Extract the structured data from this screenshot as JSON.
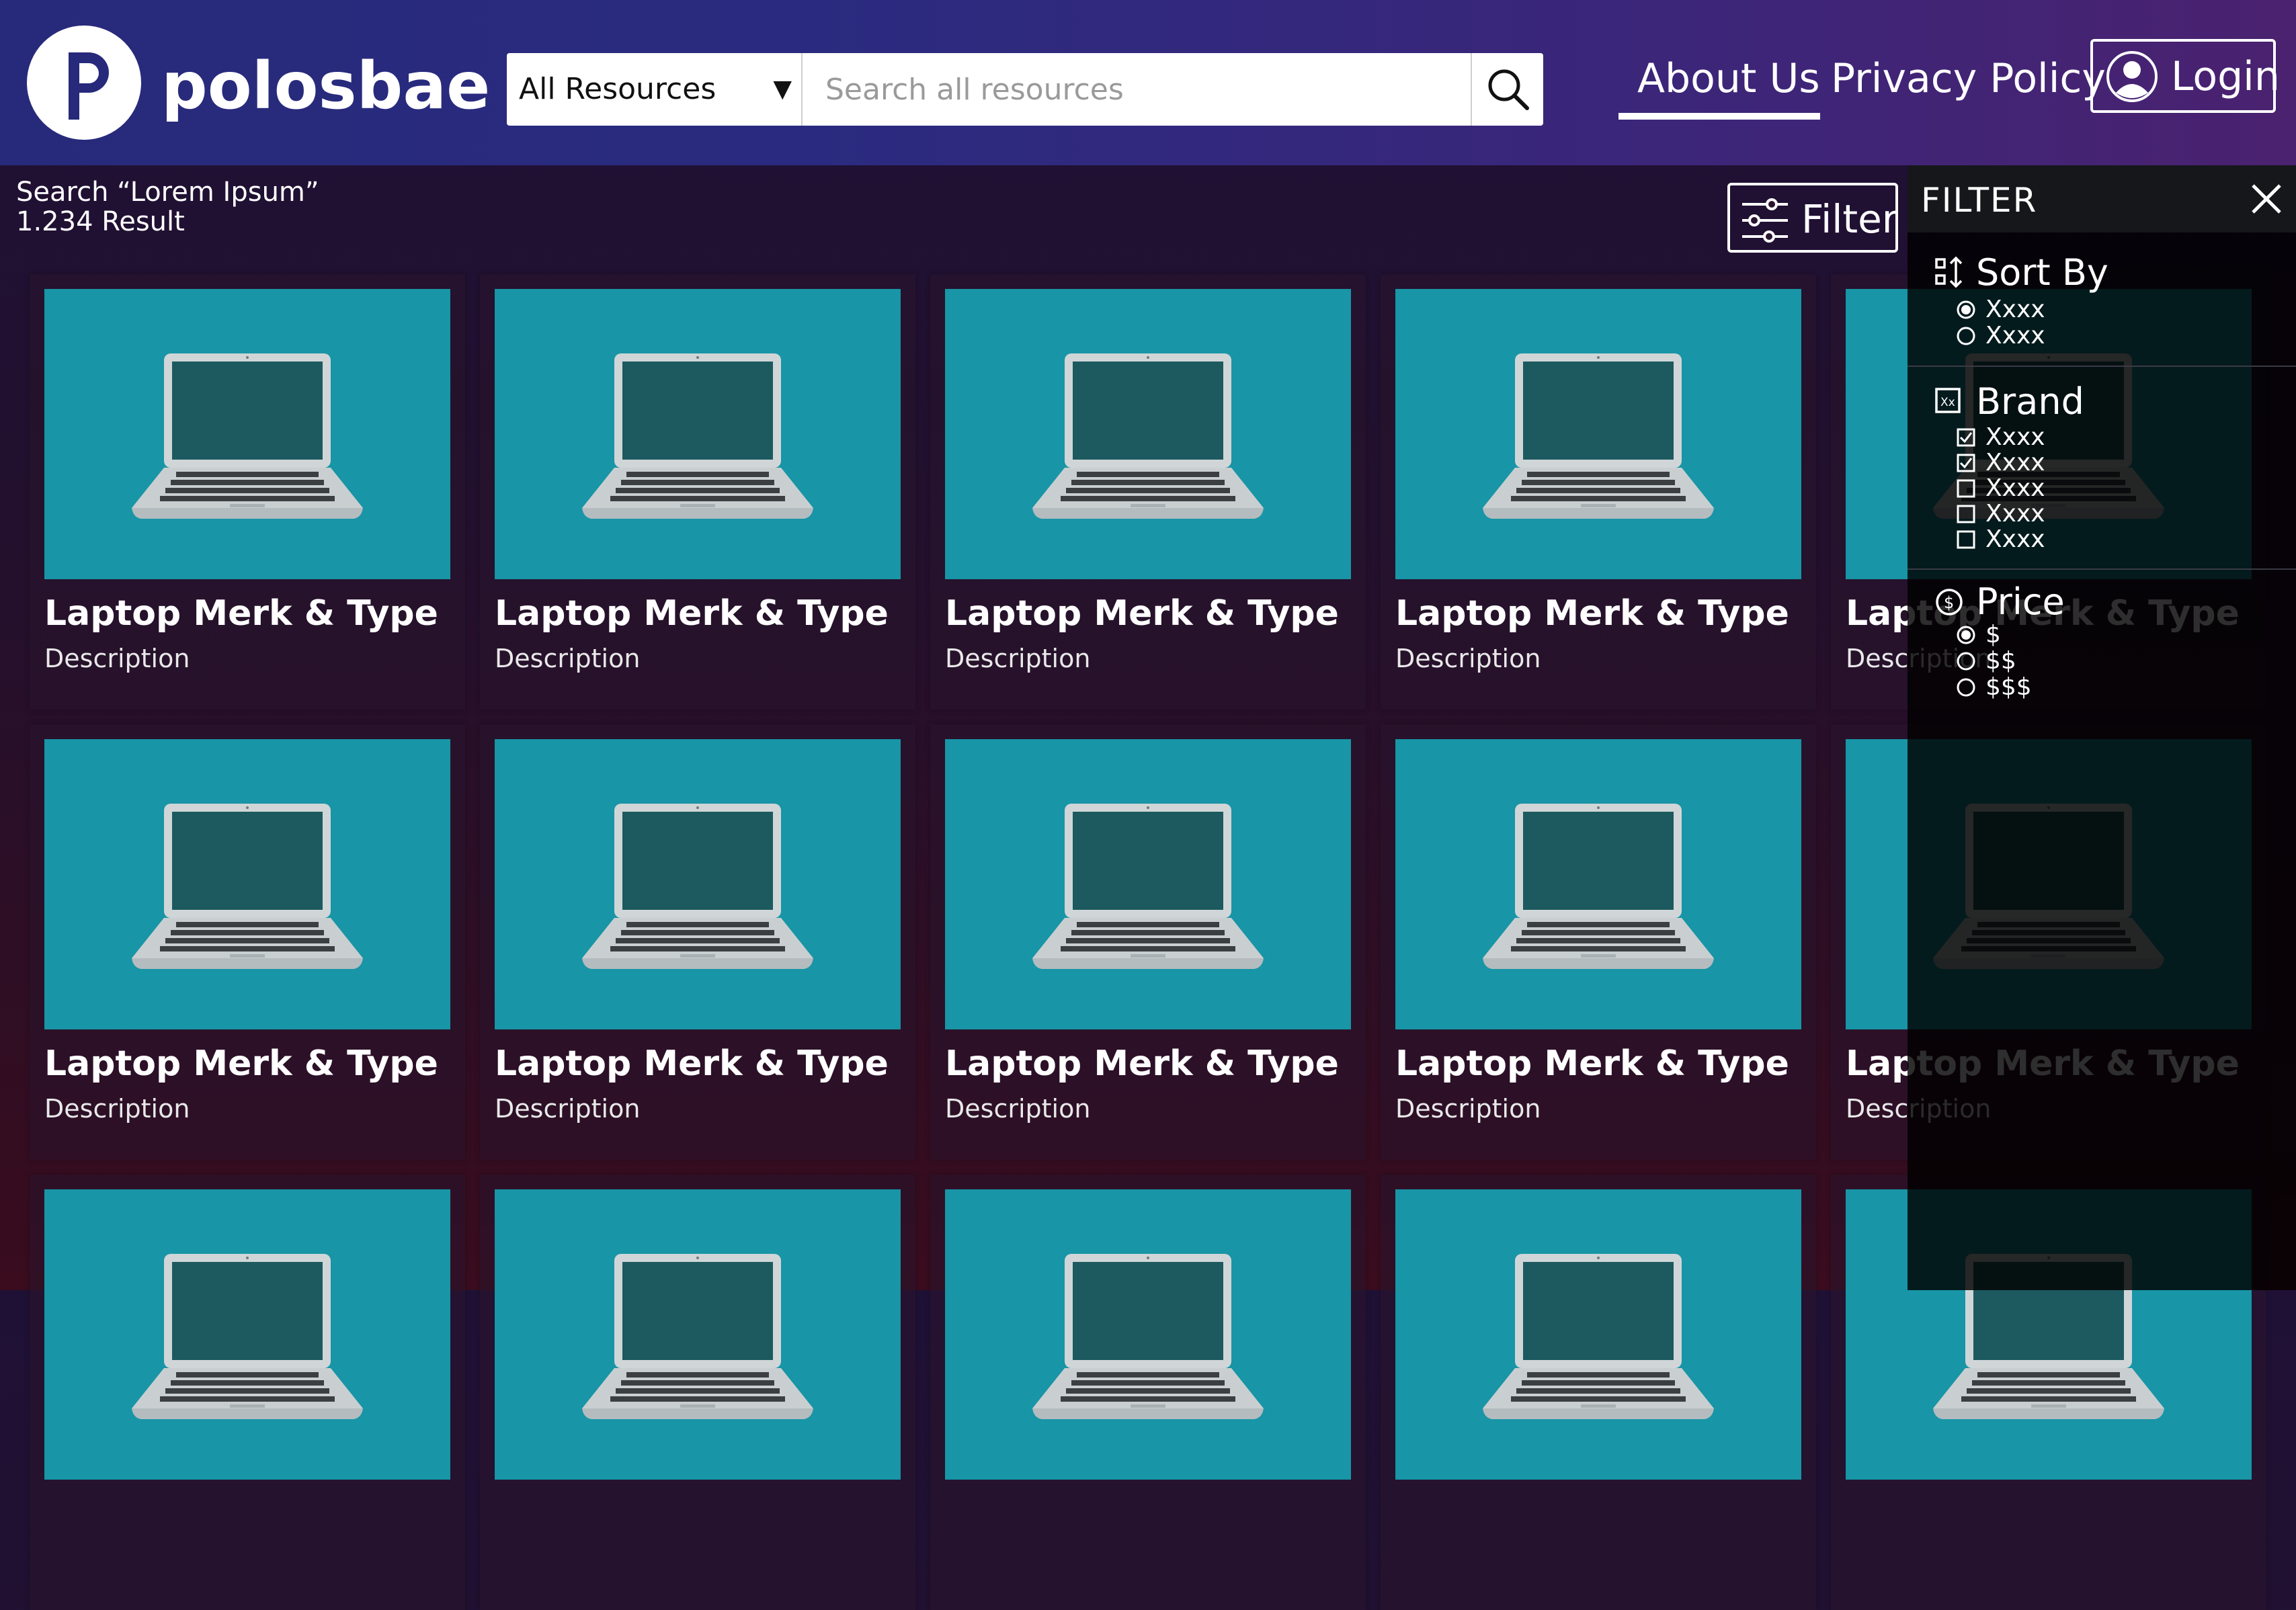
{
  "header": {
    "brand": "polosbae",
    "search_category": "All Resources",
    "search_placeholder": "Search all resources",
    "nav": [
      "About Us",
      "Privacy Policy"
    ],
    "login_label": "Login"
  },
  "results": {
    "search_term": "Search “Lorem Ipsum”",
    "count": "1.234 Result"
  },
  "filter_button_label": "Filter",
  "products": [
    {
      "title": "Laptop Merk & Type",
      "description": "Description"
    },
    {
      "title": "Laptop Merk & Type",
      "description": "Description"
    },
    {
      "title": "Laptop Merk & Type",
      "description": "Description"
    },
    {
      "title": "Laptop Merk & Type",
      "description": "Description"
    },
    {
      "title": "Laptop Merk & Type",
      "description": "Description"
    },
    {
      "title": "Laptop Merk & Type",
      "description": "Description"
    },
    {
      "title": "Laptop Merk & Type",
      "description": "Description"
    },
    {
      "title": "Laptop Merk & Type",
      "description": "Description"
    },
    {
      "title": "Laptop Merk & Type",
      "description": "Description"
    },
    {
      "title": "Laptop Merk & Type",
      "description": "Description"
    }
  ],
  "filter_panel": {
    "title": "FILTER",
    "sort_by": {
      "label": "Sort By",
      "options": [
        {
          "label": "Xxxx",
          "selected": true
        },
        {
          "label": "Xxxx",
          "selected": false
        }
      ]
    },
    "brand": {
      "label": "Brand",
      "options": [
        {
          "label": "Xxxx",
          "checked": true
        },
        {
          "label": "Xxxx",
          "checked": true
        },
        {
          "label": "Xxxx",
          "checked": false
        },
        {
          "label": "Xxxx",
          "checked": false
        },
        {
          "label": "Xxxx",
          "checked": false
        }
      ]
    },
    "price": {
      "label": "Price",
      "options": [
        {
          "label": "$",
          "selected": true
        },
        {
          "label": "$$",
          "selected": false
        },
        {
          "label": "$$$",
          "selected": false
        }
      ]
    }
  },
  "icons": {
    "search": "search-icon",
    "user": "user-icon",
    "filter": "sliders-icon",
    "close": "close-icon",
    "sort": "sort-icon",
    "brand": "brand-tag-icon",
    "price": "coin-icon",
    "product": "laptop-icon"
  },
  "colors": {
    "header_start": "#272a7a",
    "header_end": "#4a2270",
    "card_image_bg": "#1895a6",
    "laptop_screen": "#1c5a5f"
  }
}
